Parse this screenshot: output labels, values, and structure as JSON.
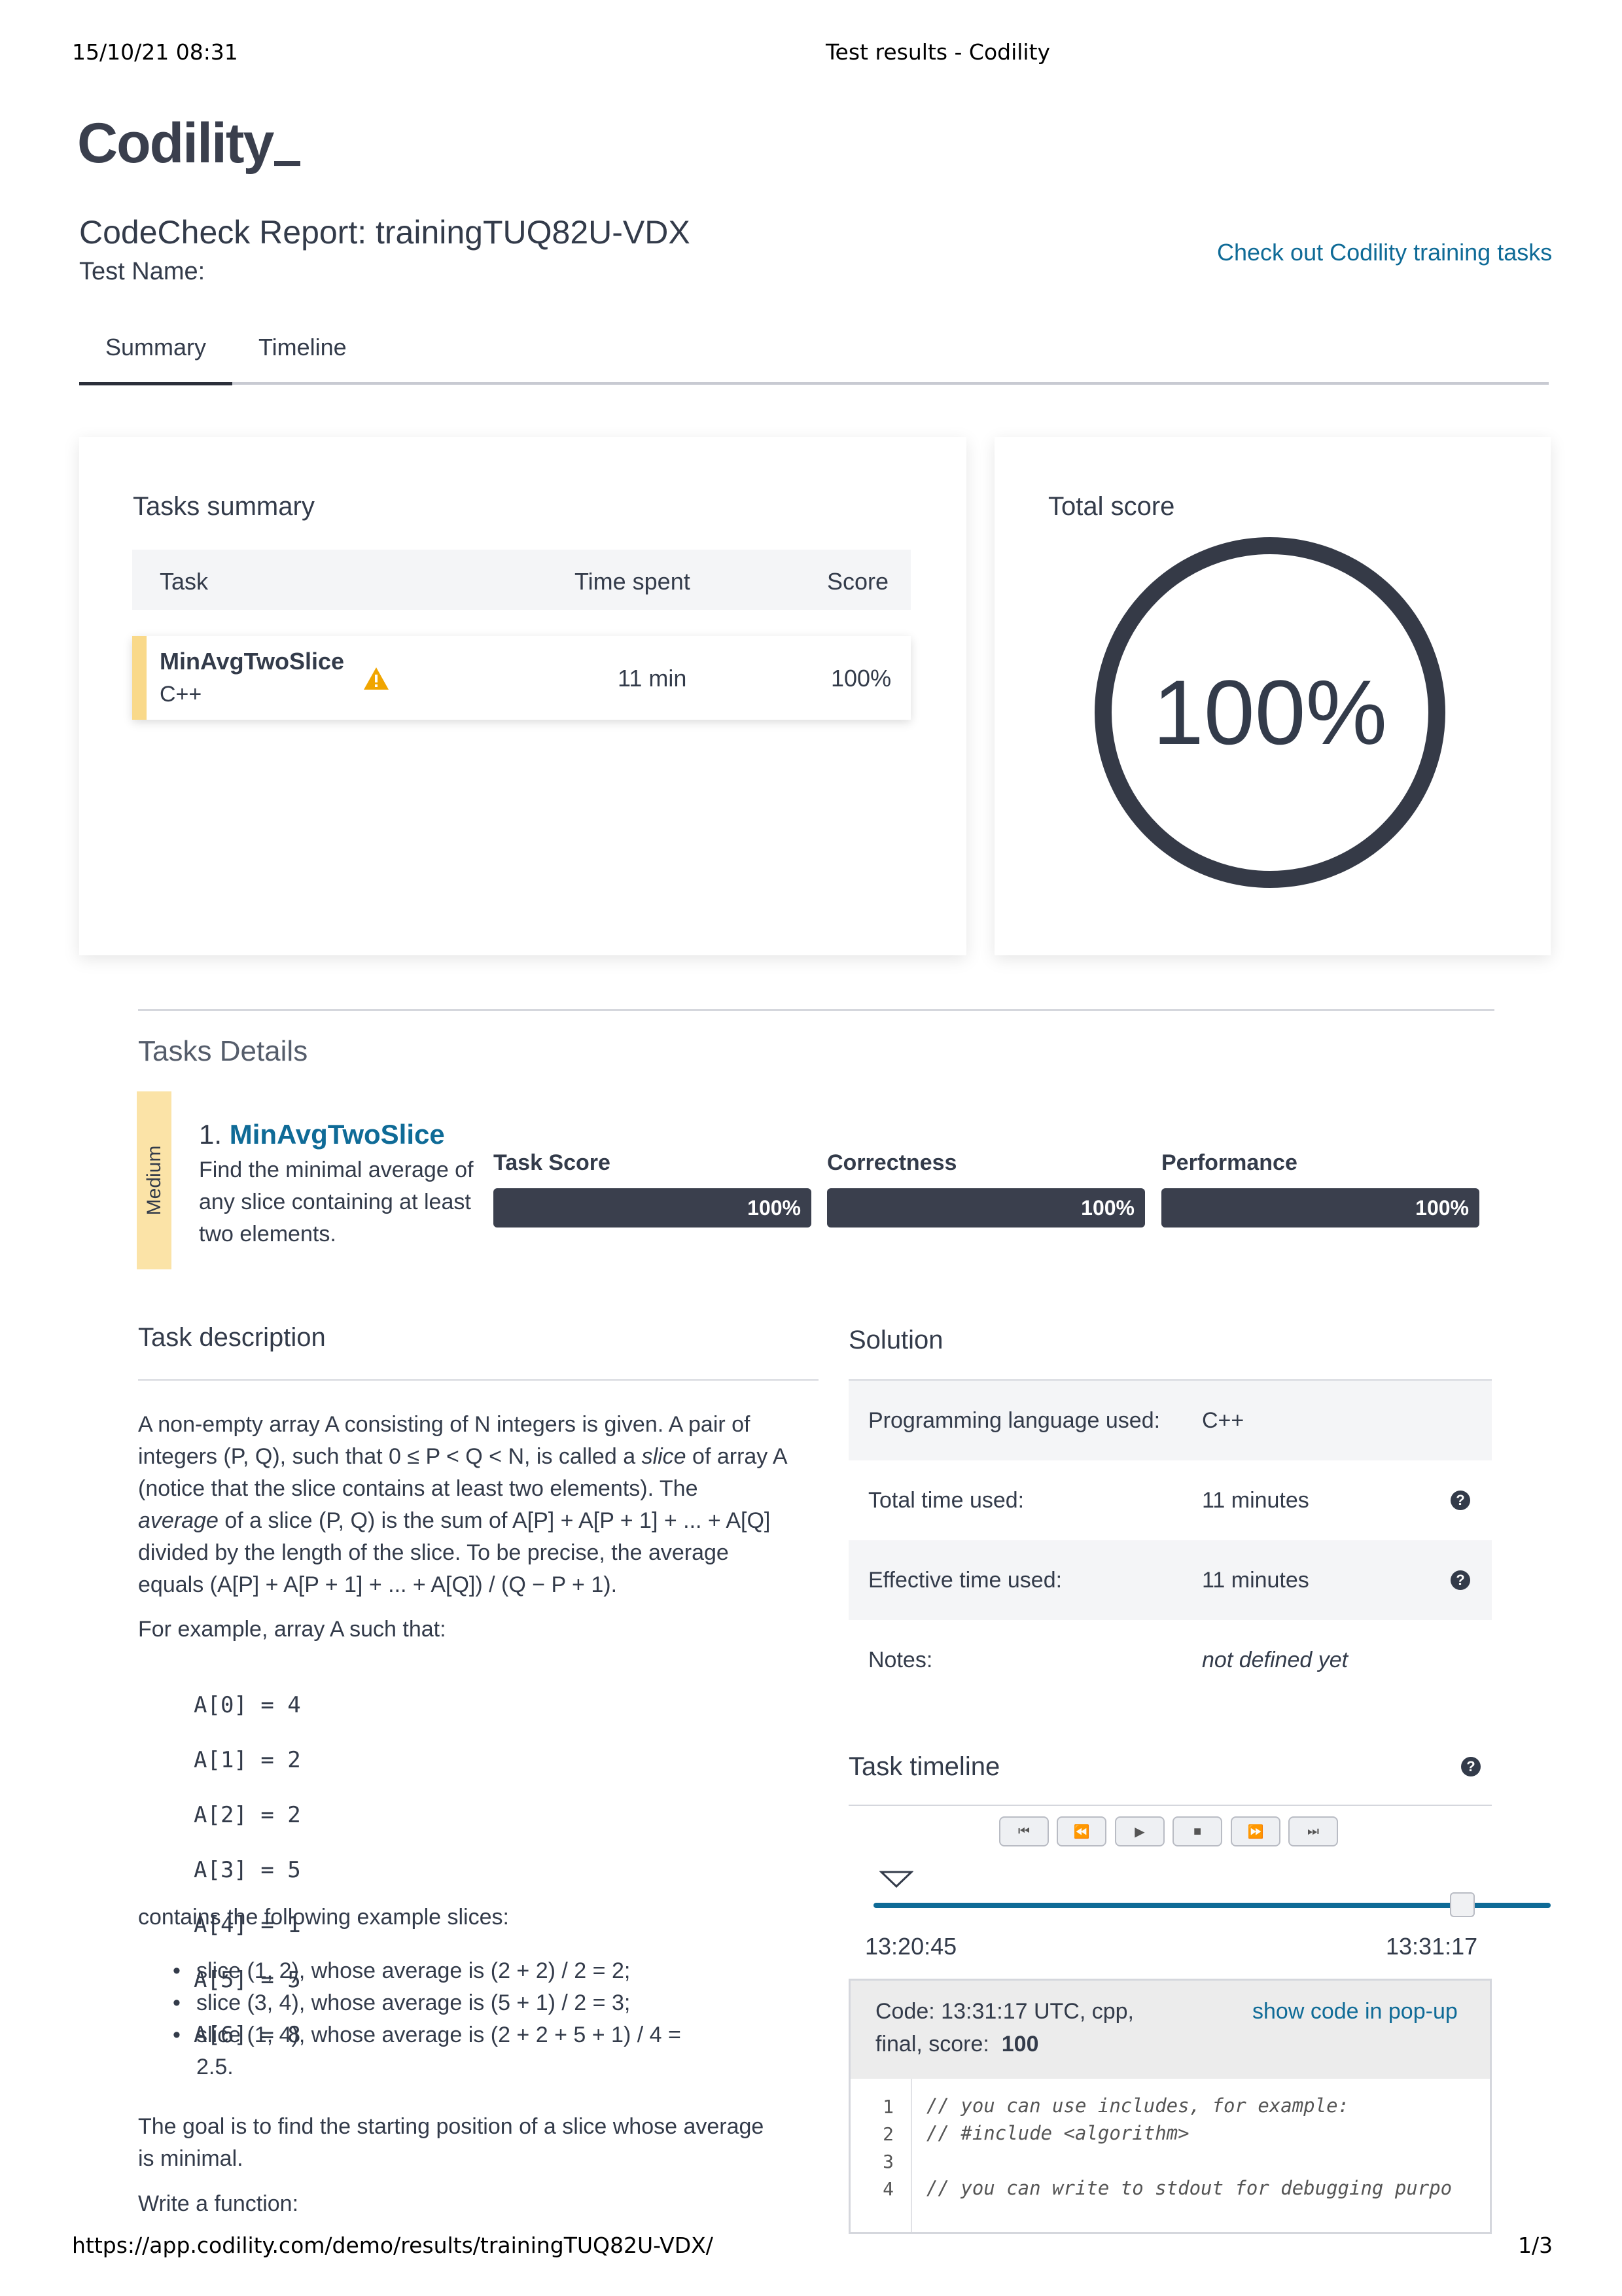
{
  "print_header": {
    "datetime": "15/10/21 08:31",
    "page_title": "Test results - Codility"
  },
  "print_footer": {
    "url": "https://app.codility.com/demo/results/trainingTUQ82U-VDX/",
    "page": "1/3"
  },
  "logo": "Codility",
  "report": {
    "title": "CodeCheck Report: trainingTUQ82U-VDX",
    "test_name_label": "Test Name:",
    "training_link": "Check out Codility training tasks"
  },
  "tabs": [
    {
      "label": "Summary",
      "active": true
    },
    {
      "label": "Timeline",
      "active": false
    }
  ],
  "tasks_summary": {
    "title": "Tasks summary",
    "columns": [
      "Task",
      "Time spent",
      "Score"
    ],
    "rows": [
      {
        "task": "MinAvgTwoSlice",
        "language": "C++",
        "warning_icon": "warning-icon",
        "time_spent": "11 min",
        "score": "100%"
      }
    ]
  },
  "total_score": {
    "title": "Total score",
    "value": "100%",
    "fraction": 1.0,
    "ring_color": "#353a47"
  },
  "tasks_details": {
    "title": "Tasks Details",
    "task": {
      "difficulty": "Medium",
      "number": "1.",
      "name": "MinAvgTwoSlice",
      "summary": "Find the minimal average of any slice containing at least two elements.",
      "metrics": [
        {
          "label": "Task Score",
          "value": "100%",
          "fraction": 1.0
        },
        {
          "label": "Correctness",
          "value": "100%",
          "fraction": 1.0
        },
        {
          "label": "Performance",
          "value": "100%",
          "fraction": 1.0
        }
      ]
    }
  },
  "task_description": {
    "title": "Task description",
    "p1_a": "A non-empty array A consisting of N integers is given. A pair of",
    "p1_b": "integers (P, Q), such that 0 ≤ P < Q < N, is called a ",
    "p1_b_em": "slice",
    "p1_b_end": " of array A",
    "p1_c": "(notice that the slice contains at least two elements). The",
    "p1_d_em": "average",
    "p1_d": " of a slice (P, Q) is the sum of A[P] + A[P + 1] + ... + A[Q]",
    "p1_e": "divided by the length of the slice. To be precise, the average",
    "p1_f": "equals (A[P] + A[P + 1] + ... + A[Q]) / (Q − P + 1).",
    "p2": "For example, array A such that:",
    "array_lines": [
      "A[0] = 4",
      "A[1] = 2",
      "A[2] = 2",
      "A[3] = 5",
      "A[4] = 1",
      "A[5] = 5",
      "A[6] = 8"
    ],
    "p3": "contains the following example slices:",
    "bullets": [
      "slice (1, 2), whose average is (2 + 2) / 2 = 2;",
      "slice (3, 4), whose average is (5 + 1) / 2 = 3;",
      "slice (1, 4), whose average is (2 + 2 + 5 + 1) / 4 ="
    ],
    "bullet_continuation": "2.5.",
    "p4_a": "The goal is to find the starting position of a slice whose average",
    "p4_b": "is minimal.",
    "p5": "Write a function:"
  },
  "solution": {
    "title": "Solution",
    "rows": [
      {
        "key": "Programming language used:",
        "value": "C++"
      },
      {
        "key": "Total time used:",
        "value": "11 minutes"
      },
      {
        "key": "Effective time used:",
        "value": "11 minutes"
      },
      {
        "key": "Notes:",
        "value": "not defined yet"
      }
    ]
  },
  "task_timeline": {
    "title": "Task timeline",
    "controls": [
      "first",
      "rewind",
      "play",
      "stop",
      "fast-forward",
      "last"
    ],
    "start_time": "13:20:45",
    "end_time": "13:31:17",
    "slider_fraction": 0.87,
    "slider_color": "#0f6b97"
  },
  "code_panel": {
    "header_line1": "Code: 13:31:17 UTC, cpp,",
    "header_line2_prefix": "final, score:",
    "header_score": "100",
    "popup_link": "show code in pop-up",
    "lines": [
      {
        "n": "1",
        "text": "// you can use includes, for example:"
      },
      {
        "n": "2",
        "text": "// #include <algorithm>"
      },
      {
        "n": "3",
        "text": ""
      },
      {
        "n": "4",
        "text": "// you can write to stdout for debugging purpo"
      }
    ]
  }
}
